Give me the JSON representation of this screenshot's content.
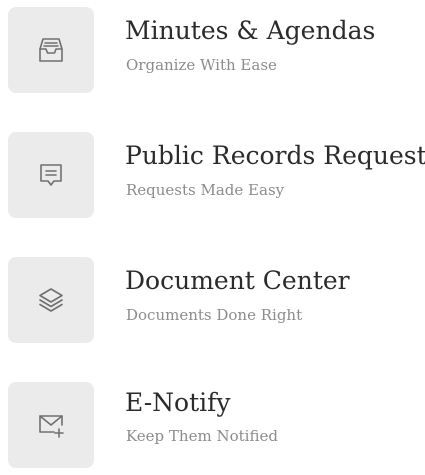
{
  "colors": {
    "tile_background": "#ebebeb",
    "icon_stroke": "#6f6f6f",
    "title_text": "#2b2b2b",
    "subtitle_text": "#8c8c8c"
  },
  "menu": {
    "items": [
      {
        "icon": "inbox-tray-icon",
        "title": "Minutes & Agendas",
        "subtitle": "Organize With Ease"
      },
      {
        "icon": "message-square-icon",
        "title": "Public Records Request",
        "subtitle": "Requests Made Easy"
      },
      {
        "icon": "layers-icon",
        "title": "Document Center",
        "subtitle": "Documents Done Right"
      },
      {
        "icon": "mail-plus-icon",
        "title": "E-Notify",
        "subtitle": "Keep Them Notified"
      }
    ]
  }
}
